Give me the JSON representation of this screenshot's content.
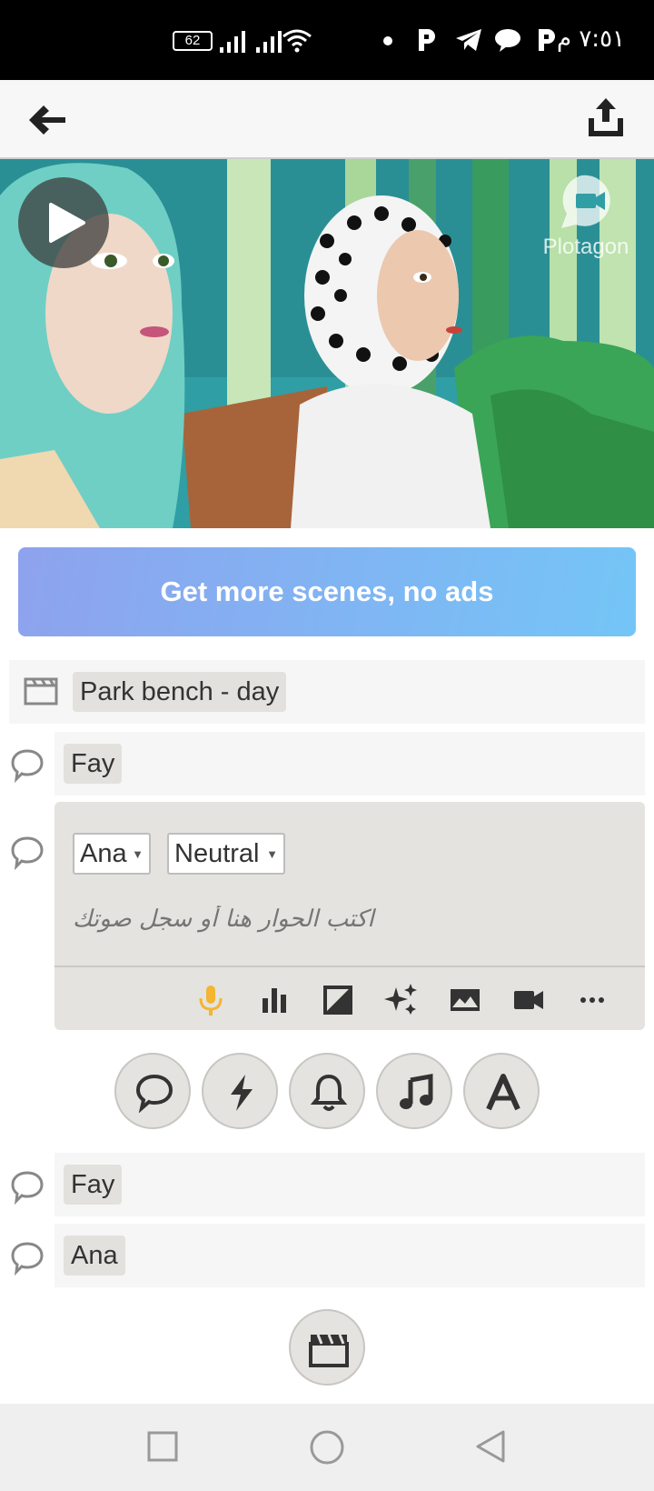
{
  "status_bar": {
    "time": "٧:٥١ م",
    "battery": "62",
    "icons": [
      "battery-icon",
      "signal-icon",
      "signal-icon",
      "wifi-icon",
      "dot-icon",
      "app-p-icon",
      "telegram-icon",
      "chat-icon",
      "app-p-icon"
    ]
  },
  "header": {
    "back_icon": "back-arrow-icon",
    "share_icon": "share-icon"
  },
  "video": {
    "play_icon": "play-icon",
    "watermark": "Plotagon"
  },
  "promo": {
    "label": "Get more scenes, no ads"
  },
  "scene": {
    "icon": "clapperboard-icon",
    "label": "Park bench - day"
  },
  "lines": [
    {
      "character": "Fay"
    },
    {
      "character": "Ana",
      "mood": "Neutral",
      "placeholder": "اكتب الحوار هنا أو سجل صوتك"
    },
    {
      "character": "Fay"
    },
    {
      "character": "Ana"
    }
  ],
  "edit_toolbar": [
    "microphone-icon",
    "bar-chart-icon",
    "image-contrast-icon",
    "sparkle-icon",
    "landscape-icon",
    "video-camera-icon",
    "more-icon"
  ],
  "add_buttons": [
    "dialogue-icon",
    "action-icon",
    "sound-effect-icon",
    "music-icon",
    "text-icon"
  ],
  "colors": {
    "accent_mic": "#f4b533",
    "promo_start": "#8ea2ee",
    "promo_end": "#74c5f7"
  },
  "nav": [
    "recent-apps-icon",
    "home-icon",
    "back-icon"
  ]
}
